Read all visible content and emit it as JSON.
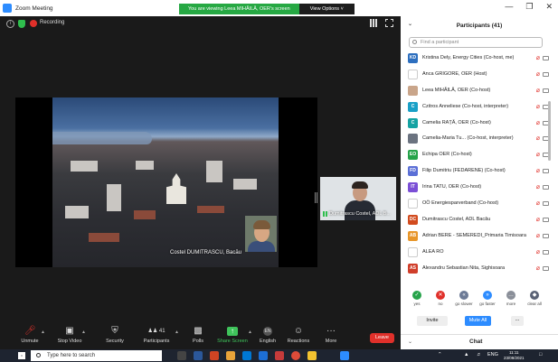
{
  "window": {
    "title": "Zoom Meeting",
    "banner_message": "You are viewing Leea MIHĂILĂ, OER's screen",
    "view_options_label": "View Options ˅",
    "minimize": "—",
    "maximize": "❐",
    "close": "✕"
  },
  "stage": {
    "recording_label": "Recording",
    "presenter_name": "Costel DUMITRASCU, Bacău",
    "thumbnail_name": "Dumitrascu Costel, ADL B..."
  },
  "toolbar": {
    "items": [
      {
        "label": "Unmute",
        "icon": "mic-muted-icon"
      },
      {
        "label": "Stop Video",
        "icon": "video-icon"
      },
      {
        "label": "Security",
        "icon": "shield-icon"
      },
      {
        "label": "Participants",
        "icon": "participants-icon",
        "count": "41"
      },
      {
        "label": "Polls",
        "icon": "polls-icon"
      },
      {
        "label": "Share Screen",
        "icon": "share-screen-icon"
      },
      {
        "label": "English",
        "icon": "interpretation-icon",
        "badge": "EN"
      },
      {
        "label": "Reactions",
        "icon": "reactions-icon"
      },
      {
        "label": "More",
        "icon": "more-icon"
      }
    ],
    "leave_label": "Leave"
  },
  "participants_panel": {
    "title": "Participants (41)",
    "search_placeholder": "Find a participant",
    "participants": [
      {
        "initials": "KD",
        "name": "Kristina Dely, Energy Cities (Co-host, me)",
        "color": "#2d6fbf"
      },
      {
        "initials": "",
        "name": "Anca GRIGORE, OER (Host)",
        "color": "#ffffff"
      },
      {
        "initials": "",
        "name": "Leea MIHĂILĂ, OER (Co-host)",
        "color": "#c9a58a"
      },
      {
        "initials": "C",
        "name": "Czitros Anneliese (Co-host, interpreter)",
        "color": "#1aa0c7"
      },
      {
        "initials": "C",
        "name": "Camelia RAȚĂ, OER (Co-host)",
        "color": "#15a3a3"
      },
      {
        "initials": "",
        "name": "Camelia-Maria Tu... (Co-host, interpreter)",
        "color": "#6b7380"
      },
      {
        "initials": "EO",
        "name": "Echipa OER (Co-host)",
        "color": "#26a34a"
      },
      {
        "initials": "FD",
        "name": "Filip Dumitriu (FEDARENE) (Co-host)",
        "color": "#5b6fd6"
      },
      {
        "initials": "IT",
        "name": "Irina TATU, OER (Co-host)",
        "color": "#7b4fd6"
      },
      {
        "initials": "",
        "name": "OÖ Energiesparverband (Co-host)",
        "color": "#ffffff"
      },
      {
        "initials": "DC",
        "name": "Dumitrascu Costel, ADL Bacău",
        "color": "#d24b1e"
      },
      {
        "initials": "AB",
        "name": "Adrian BERE - SEMEREDI_Primaria Timisoara",
        "color": "#e8962a"
      },
      {
        "initials": "",
        "name": "ALEA RO",
        "color": "#ffffff"
      },
      {
        "initials": "AS",
        "name": "Alexandru Sebastian Nita, Sighisoara",
        "color": "#d03e2a"
      }
    ],
    "reactions": [
      {
        "label": "yes",
        "glyph": "✓",
        "color": "#26a34a"
      },
      {
        "label": "no",
        "glyph": "✕",
        "color": "#e0302a"
      },
      {
        "label": "go slower",
        "glyph": "«",
        "color": "#6c7a96"
      },
      {
        "label": "go faster",
        "glyph": "»",
        "color": "#2d8cff"
      },
      {
        "label": "more",
        "glyph": "…",
        "color": "#8a8f99"
      },
      {
        "label": "clear all",
        "glyph": "◆",
        "color": "#5a6275"
      }
    ],
    "invite_label": "Invite",
    "mute_all_label": "Mute All",
    "more_label": "...",
    "chat_label": "Chat"
  },
  "taskbar": {
    "search_placeholder": "Type here to search",
    "language": "ENG",
    "time": "11:11",
    "date": "23/09/2021"
  },
  "colors": {
    "accent": "#2d8cff",
    "banner_green": "#26a843",
    "leave_red": "#e0302a",
    "muted_red": "#e0302a"
  }
}
